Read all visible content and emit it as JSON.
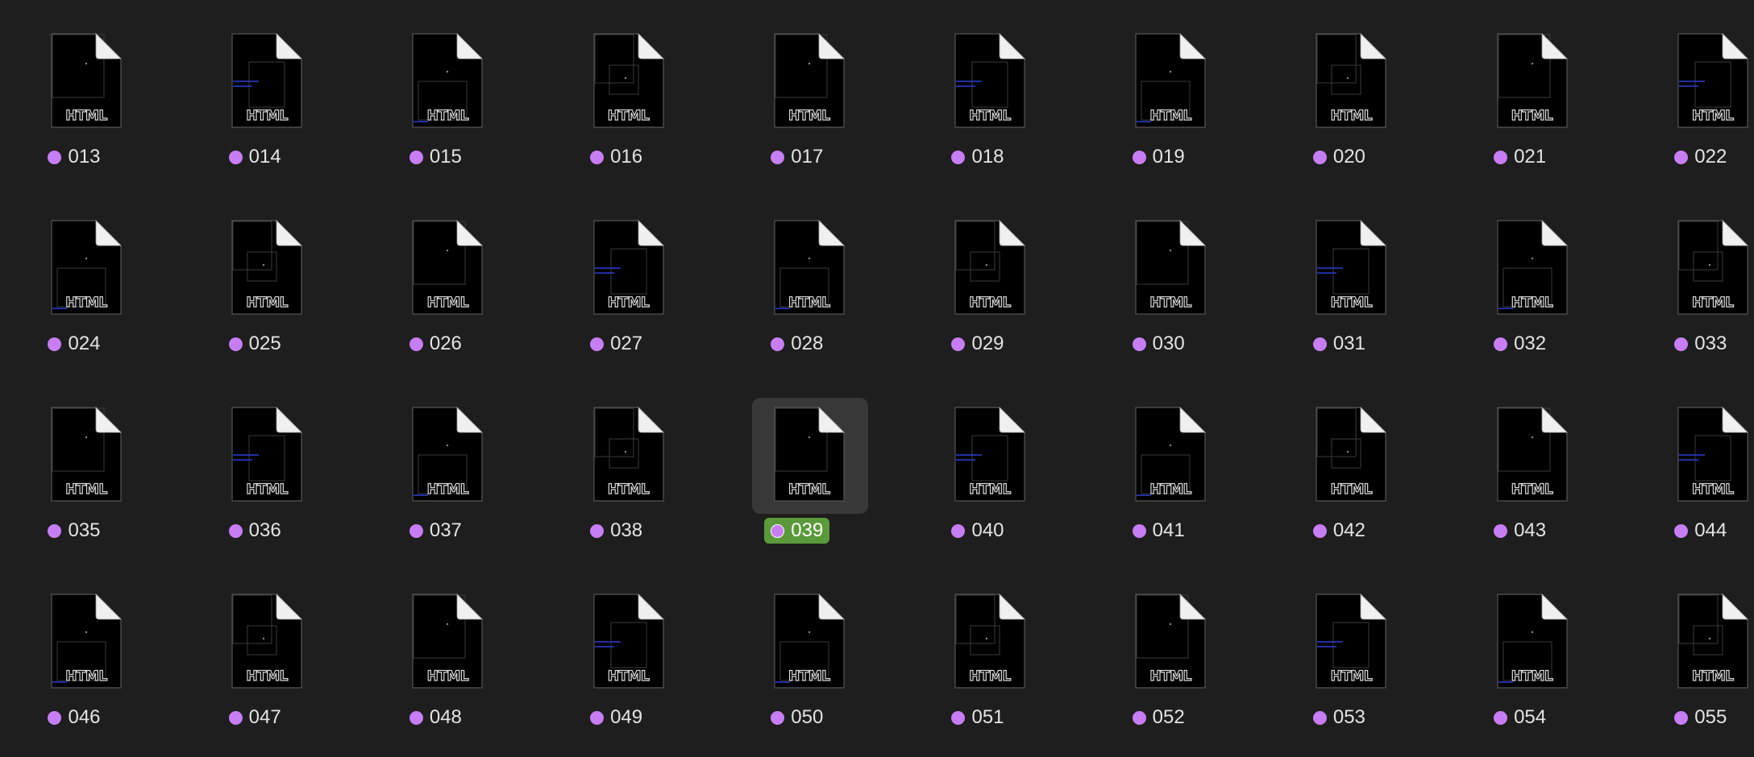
{
  "accent": {
    "tag_color": "#c77df3",
    "selection_color": "#5a9a3a"
  },
  "rows": [
    {
      "items": [
        {
          "name": "013",
          "badge": "HTML",
          "icon": "html-file-icon",
          "tag": "purple"
        },
        {
          "name": "014",
          "badge": "HTML",
          "icon": "html-file-icon",
          "tag": "purple"
        },
        {
          "name": "015",
          "badge": "HTML",
          "icon": "html-file-icon",
          "tag": "purple"
        },
        {
          "name": "016",
          "badge": "HTML",
          "icon": "html-file-icon",
          "tag": "purple"
        },
        {
          "name": "017",
          "badge": "HTML",
          "icon": "html-file-icon",
          "tag": "purple"
        },
        {
          "name": "018",
          "badge": "HTML",
          "icon": "html-file-icon",
          "tag": "purple"
        },
        {
          "name": "019",
          "badge": "HTML",
          "icon": "html-file-icon",
          "tag": "purple"
        },
        {
          "name": "020",
          "badge": "HTML",
          "icon": "html-file-icon",
          "tag": "purple"
        },
        {
          "name": "021",
          "badge": "HTML",
          "icon": "html-file-icon",
          "tag": "purple"
        },
        {
          "name": "022",
          "badge": "HTML",
          "icon": "html-file-icon",
          "tag": "purple"
        }
      ]
    },
    {
      "items": [
        {
          "name": "024",
          "badge": "HTML",
          "icon": "html-file-icon",
          "tag": "purple"
        },
        {
          "name": "025",
          "badge": "HTML",
          "icon": "html-file-icon",
          "tag": "purple"
        },
        {
          "name": "026",
          "badge": "HTML",
          "icon": "html-file-icon",
          "tag": "purple"
        },
        {
          "name": "027",
          "badge": "HTML",
          "icon": "html-file-icon",
          "tag": "purple"
        },
        {
          "name": "028",
          "badge": "HTML",
          "icon": "html-file-icon",
          "tag": "purple"
        },
        {
          "name": "029",
          "badge": "HTML",
          "icon": "html-file-icon",
          "tag": "purple"
        },
        {
          "name": "030",
          "badge": "HTML",
          "icon": "html-file-icon",
          "tag": "purple"
        },
        {
          "name": "031",
          "badge": "HTML",
          "icon": "html-file-icon",
          "tag": "purple"
        },
        {
          "name": "032",
          "badge": "HTML",
          "icon": "html-file-icon",
          "tag": "purple"
        },
        {
          "name": "033",
          "badge": "HTML",
          "icon": "html-file-icon",
          "tag": "purple"
        }
      ]
    },
    {
      "items": [
        {
          "name": "035",
          "badge": "HTML",
          "icon": "html-file-icon",
          "tag": "purple"
        },
        {
          "name": "036",
          "badge": "HTML",
          "icon": "html-file-icon",
          "tag": "purple"
        },
        {
          "name": "037",
          "badge": "HTML",
          "icon": "html-file-icon",
          "tag": "purple"
        },
        {
          "name": "038",
          "badge": "HTML",
          "icon": "html-file-icon",
          "tag": "purple"
        },
        {
          "name": "039",
          "badge": "HTML",
          "icon": "html-file-icon",
          "tag": "purple",
          "selected": true
        },
        {
          "name": "040",
          "badge": "HTML",
          "icon": "html-file-icon",
          "tag": "purple"
        },
        {
          "name": "041",
          "badge": "HTML",
          "icon": "html-file-icon",
          "tag": "purple"
        },
        {
          "name": "042",
          "badge": "HTML",
          "icon": "html-file-icon",
          "tag": "purple"
        },
        {
          "name": "043",
          "badge": "HTML",
          "icon": "html-file-icon",
          "tag": "purple"
        },
        {
          "name": "044",
          "badge": "HTML",
          "icon": "html-file-icon",
          "tag": "purple"
        }
      ]
    },
    {
      "items": [
        {
          "name": "046",
          "badge": "HTML",
          "icon": "html-file-icon",
          "tag": "purple"
        },
        {
          "name": "047",
          "badge": "HTML",
          "icon": "html-file-icon",
          "tag": "purple"
        },
        {
          "name": "048",
          "badge": "HTML",
          "icon": "html-file-icon",
          "tag": "purple"
        },
        {
          "name": "049",
          "badge": "HTML",
          "icon": "html-file-icon",
          "tag": "purple"
        },
        {
          "name": "050",
          "badge": "HTML",
          "icon": "html-file-icon",
          "tag": "purple"
        },
        {
          "name": "051",
          "badge": "HTML",
          "icon": "html-file-icon",
          "tag": "purple"
        },
        {
          "name": "052",
          "badge": "HTML",
          "icon": "html-file-icon",
          "tag": "purple"
        },
        {
          "name": "053",
          "badge": "HTML",
          "icon": "html-file-icon",
          "tag": "purple"
        },
        {
          "name": "054",
          "badge": "HTML",
          "icon": "html-file-icon",
          "tag": "purple"
        },
        {
          "name": "055",
          "badge": "HTML",
          "icon": "html-file-icon",
          "tag": "purple"
        }
      ]
    }
  ]
}
